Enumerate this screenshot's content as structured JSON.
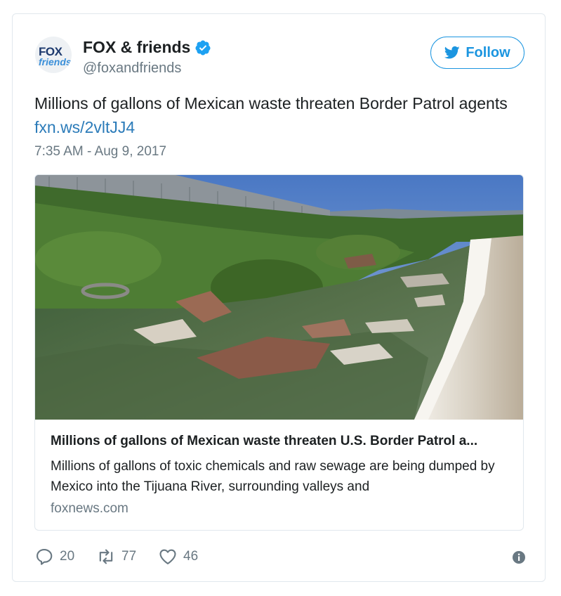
{
  "tweet": {
    "account": {
      "display_name": "FOX & friends",
      "handle": "@foxandfriends",
      "avatar_logo_top": "FOX",
      "avatar_logo_bottom": "friends",
      "verified_icon": "verified-badge-icon"
    },
    "follow_label": "Follow",
    "text": "Millions of gallons of Mexican waste threaten Border Patrol agents",
    "link_text": "fxn.ws/2vltJJ4",
    "timestamp": "7:35 AM - Aug 9, 2017",
    "link_card": {
      "image_icon": "river-waste-photo",
      "title": "Millions of gallons of Mexican waste threaten U.S. Border Patrol a...",
      "description": "Millions of gallons of toxic chemicals and raw sewage are being dumped by Mexico into the Tijuana River, surrounding valleys and",
      "domain": "foxnews.com"
    },
    "actions": {
      "replies": "20",
      "retweets": "77",
      "likes": "46"
    }
  },
  "colors": {
    "accent": "#1b95e0",
    "link": "#2b7bb9",
    "muted": "#697882",
    "border": "#e1e8ed"
  }
}
